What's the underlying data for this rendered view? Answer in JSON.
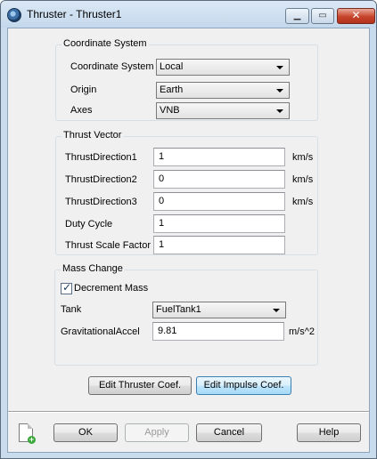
{
  "window": {
    "title": "Thruster - Thruster1",
    "minimize_glyph": "▁",
    "maximize_glyph": "▭",
    "close_glyph": "✕"
  },
  "coordinate_system": {
    "group_label": "Coordinate System",
    "coord_label": "Coordinate System",
    "coord_value": "Local",
    "origin_label": "Origin",
    "origin_value": "Earth",
    "axes_label": "Axes",
    "axes_value": "VNB"
  },
  "thrust_vector": {
    "group_label": "Thrust Vector",
    "dir1_label": "ThrustDirection1",
    "dir1_value": "1",
    "dir1_unit": "km/s",
    "dir2_label": "ThrustDirection2",
    "dir2_value": "0",
    "dir2_unit": "km/s",
    "dir3_label": "ThrustDirection3",
    "dir3_value": "0",
    "dir3_unit": "km/s",
    "duty_label": "Duty Cycle",
    "duty_value": "1",
    "scale_label": "Thrust Scale Factor",
    "scale_value": "1"
  },
  "mass_change": {
    "group_label": "Mass Change",
    "decrement_label": "Decrement Mass",
    "decrement_checked": true,
    "tank_label": "Tank",
    "tank_value": "FuelTank1",
    "grav_label": "GravitationalAccel",
    "grav_value": "9.81",
    "grav_unit": "m/s^2"
  },
  "coef_buttons": {
    "thruster": "Edit Thruster Coef.",
    "impulse": "Edit Impulse Coef."
  },
  "footer": {
    "ok": "OK",
    "apply": "Apply",
    "cancel": "Cancel",
    "help": "Help"
  }
}
